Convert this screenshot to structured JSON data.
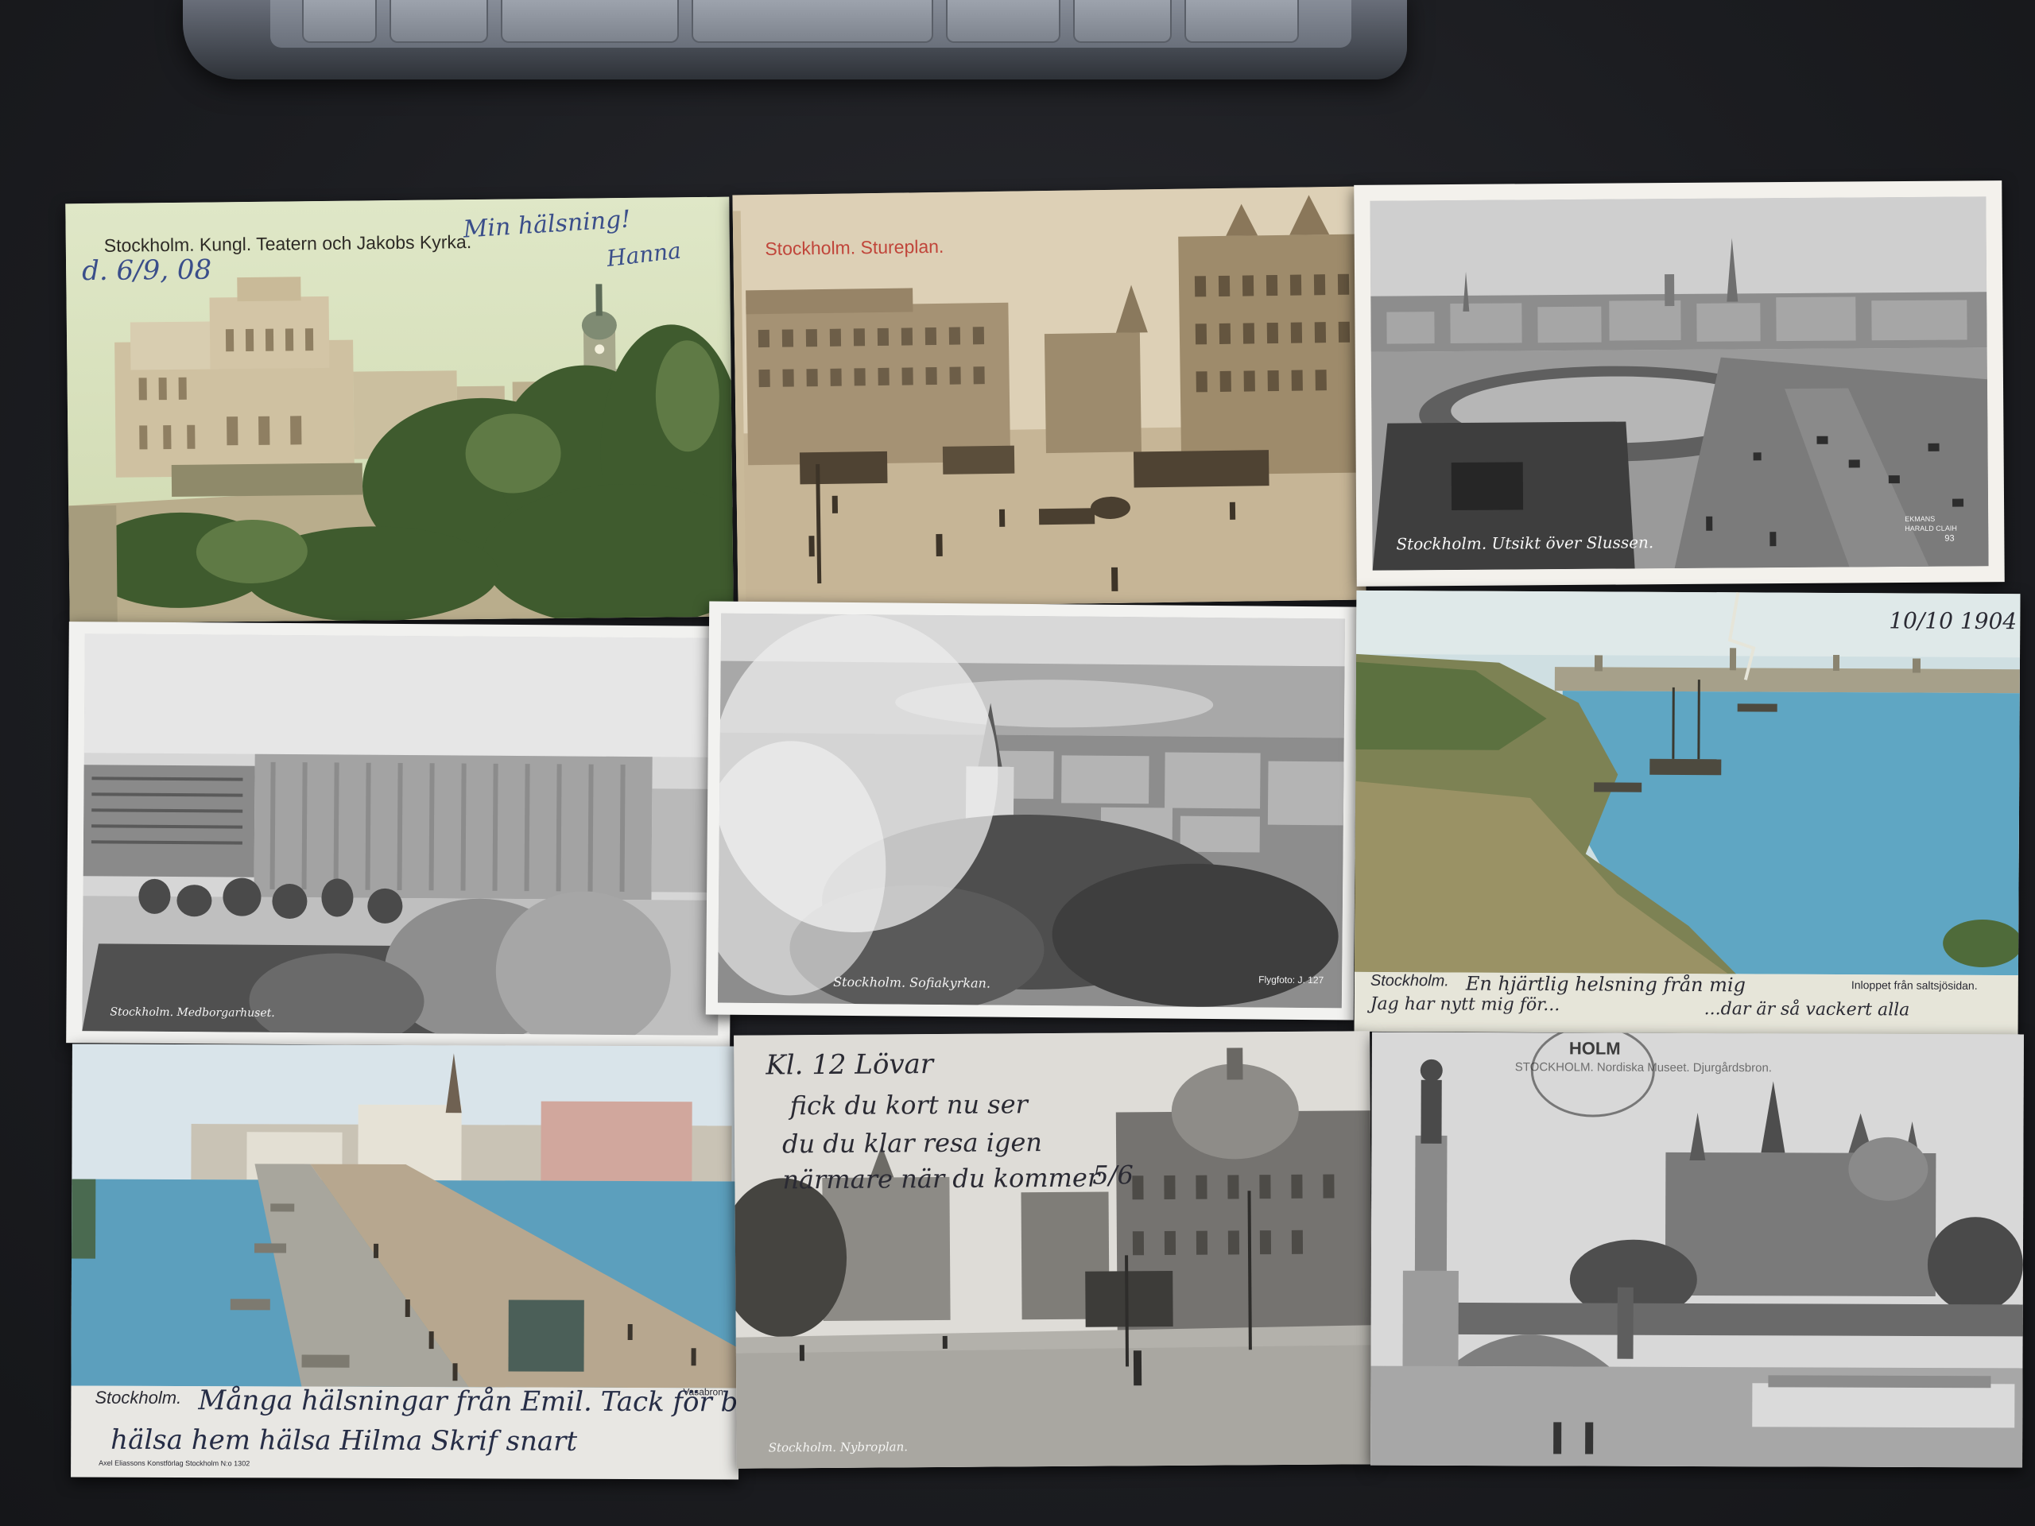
{
  "scene": {
    "description_colors": {
      "table": "#1d1e22",
      "keyboard": "#5b6069"
    }
  },
  "postcards": [
    {
      "id": "kungl-teatern",
      "caption": "Stockholm. Kungl. Teatern och Jakobs Kyrka.",
      "handwriting": [
        "Min hälsning!",
        "Hanna",
        "d. 6/9, 08"
      ]
    },
    {
      "id": "stureplan",
      "caption": "Stockholm. Stureplan.",
      "caption_color": "#c0453a"
    },
    {
      "id": "slussen",
      "caption": "Stockholm. Utsikt över Slussen.",
      "imprint": [
        "EKMANS",
        "HARALD CLAIH",
        "93"
      ]
    },
    {
      "id": "medborgarhuset",
      "caption": "Stockholm. Medborgarhuset."
    },
    {
      "id": "sofiakyrkan",
      "caption": "Stockholm. Sofiakyrkan.",
      "imprint": [
        "Flygfoto: J. 127"
      ]
    },
    {
      "id": "saltsjon",
      "caption": "Stockholm.",
      "subcaption": "Inloppet från saltsjösidan.",
      "date": "10/10 1904",
      "handwriting": [
        "En hjärtlig helsning från mig",
        "Jag har nytt mig för...",
        "...dar är så vackert alla"
      ]
    },
    {
      "id": "vasabron",
      "caption": "Stockholm.",
      "small_caption": "Vasabron",
      "publisher": "Axel Eliassons Konstförlag Stockholm N:o 1302",
      "handwriting": [
        "Många hälsningar från Emil. Tack för brefet",
        "hälsa hem hälsa Hilma Skrif snart"
      ]
    },
    {
      "id": "nybroplan",
      "caption": "Stockholm. Nybroplan.",
      "handwriting": [
        "Kl. 12 Lövar",
        "fick du kort nu ser",
        "du du klar resa igen",
        "närmare när du kommer",
        "5/6"
      ]
    },
    {
      "id": "nordiska",
      "caption": "STOCKHOLM. Nordiska Museet. Djurgårdsbron.",
      "postmark": "HOLM"
    }
  ]
}
